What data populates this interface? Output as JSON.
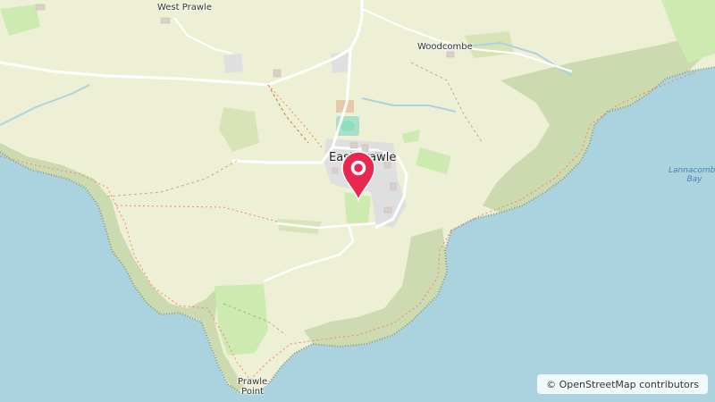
{
  "map": {
    "places": {
      "west_prawle": "West Prawle",
      "woodcombe": "Woodcombe",
      "east_prawle": "East Prawle",
      "prawle_point_line1": "Prawle",
      "prawle_point_line2": "Point",
      "lannacombe_line1": "Lannacombe",
      "lannacombe_line2": "Bay"
    },
    "marker": {
      "icon": "map-pin-icon",
      "color": "#e8294f"
    },
    "attribution": "© OpenStreetMap contributors",
    "colors": {
      "sea": "#aad3df",
      "farmland": "#eef0d5",
      "scrub": "#c8d7ab",
      "grass": "#cdebb0",
      "road": "#ffffff",
      "track": "#ac8327"
    }
  }
}
